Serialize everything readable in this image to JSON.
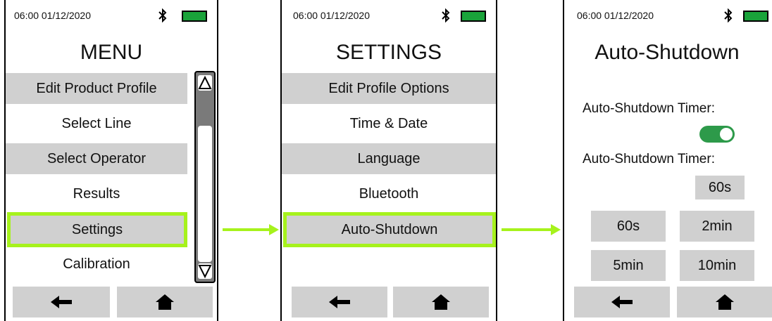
{
  "accent_color": "#a6f21c",
  "battery_color": "#1aa33a",
  "status": {
    "time_date": "06:00   01/12/2020",
    "bluetooth_icon": "bluetooth-icon",
    "battery_icon": "battery-icon"
  },
  "menu": {
    "title": "MENU",
    "items": [
      "Edit Product Profile",
      "Select Line",
      "Select Operator",
      "Results",
      "Settings",
      "Calibration"
    ],
    "highlighted": "Settings"
  },
  "settings": {
    "title": "SETTINGS",
    "items": [
      "Edit Profile Options",
      "Time & Date",
      "Language",
      "Bluetooth",
      "Auto-Shutdown"
    ],
    "highlighted": "Auto-Shutdown"
  },
  "autoshutdown": {
    "title": "Auto-Shutdown",
    "timer_label_1": "Auto-Shutdown Timer:",
    "toggle_on": true,
    "timer_label_2": "Auto-Shutdown Timer:",
    "current_value": "60s",
    "options": [
      "60s",
      "2min",
      "5min",
      "10min"
    ]
  },
  "nav": {
    "back_glyph": "🡐",
    "home_glyph": "⌂"
  }
}
